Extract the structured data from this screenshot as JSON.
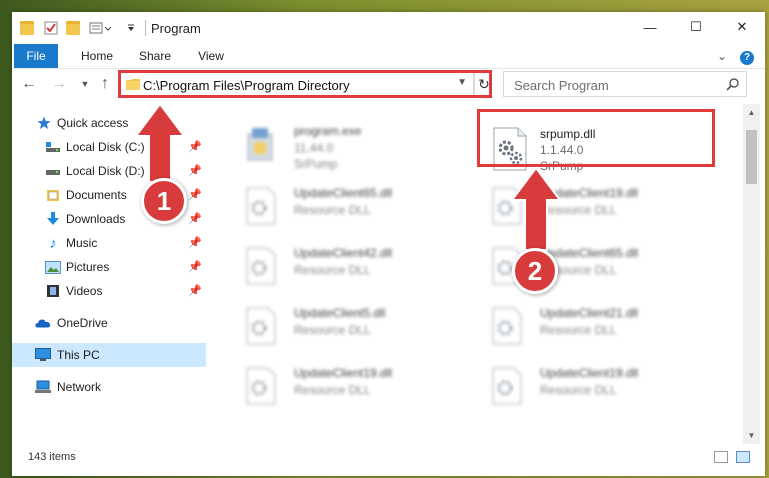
{
  "window": {
    "title": "Program",
    "controls": {
      "minimize": "—",
      "maximize": "☐",
      "close": "✕"
    }
  },
  "ribbon": {
    "tabs": [
      "File",
      "Home",
      "Share",
      "View"
    ],
    "expand_glyph": "⌄",
    "help_glyph": "?"
  },
  "address": {
    "path": "C:\\Program Files\\Program Directory",
    "search_placeholder": "Search Program"
  },
  "nav": {
    "items": [
      {
        "label": "Quick access",
        "icon": "star-icon",
        "pinned": false
      },
      {
        "label": "Local Disk (C:)",
        "icon": "drive-icon",
        "pinned": true
      },
      {
        "label": "Local Disk (D:)",
        "icon": "drive-icon",
        "pinned": true
      },
      {
        "label": "Documents",
        "icon": "documents-icon",
        "pinned": true
      },
      {
        "label": "Downloads",
        "icon": "downloads-icon",
        "pinned": true
      },
      {
        "label": "Music",
        "icon": "music-icon",
        "pinned": true
      },
      {
        "label": "Pictures",
        "icon": "pictures-icon",
        "pinned": true
      },
      {
        "label": "Videos",
        "icon": "videos-icon",
        "pinned": true
      },
      {
        "label": "OneDrive",
        "icon": "onedrive-icon",
        "pinned": false
      },
      {
        "label": "This PC",
        "icon": "this-pc-icon",
        "pinned": false,
        "selected": true
      },
      {
        "label": "Network",
        "icon": "network-icon",
        "pinned": false
      }
    ]
  },
  "files": [
    {
      "name": "program.exe",
      "line2": "11.44.0",
      "line3": "SrPump",
      "icon": "exe-icon",
      "blurred": true
    },
    {
      "name": "srpump.dll",
      "line2": "1.1.44.0",
      "line3": "SrPump",
      "icon": "dll-gear-icon",
      "blurred": false,
      "highlighted": true
    },
    {
      "name": "UpdateClient65.dll",
      "line2": "Resource DLL",
      "icon": "dll-icon",
      "blurred": true
    },
    {
      "name": "UpdateClient19.dll",
      "line2": "Resource DLL",
      "icon": "dll-icon",
      "blurred": true
    },
    {
      "name": "UpdateClient42.dll",
      "line2": "Resource DLL",
      "icon": "dll-icon",
      "blurred": true
    },
    {
      "name": "UpdateClient65.dll",
      "line2": "Resource DLL",
      "icon": "dll-icon",
      "blurred": true
    },
    {
      "name": "UpdateClient5.dll",
      "line2": "Resource DLL",
      "icon": "dll-icon",
      "blurred": true
    },
    {
      "name": "UpdateClient21.dll",
      "line2": "Resource DLL",
      "icon": "dll-icon",
      "blurred": true
    },
    {
      "name": "UpdateClient19.dll",
      "line2": "Resource DLL",
      "icon": "dll-icon",
      "blurred": true
    },
    {
      "name": "UpdateClient19.dll",
      "line2": "Resource DLL",
      "icon": "dll-icon",
      "blurred": true
    }
  ],
  "status": {
    "count": "143 items"
  },
  "annotations": {
    "step1": "1",
    "step2": "2",
    "color": "#d83b3b"
  }
}
